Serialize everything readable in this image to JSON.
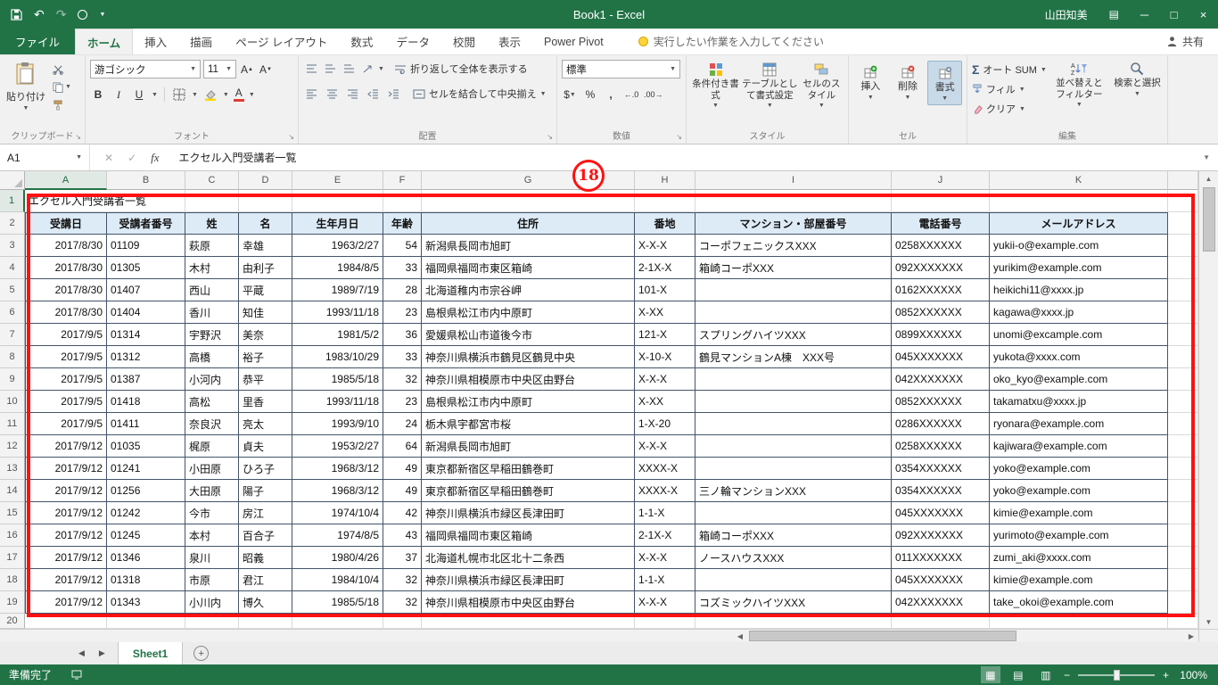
{
  "title_bar": {
    "title": "Book1 - Excel",
    "user_name": "山田知美",
    "minimize": "─",
    "maximize": "□",
    "close": "×"
  },
  "ribbon_tabs": {
    "file": "ファイル",
    "tabs": [
      "ホーム",
      "挿入",
      "描画",
      "ページ レイアウト",
      "数式",
      "データ",
      "校閲",
      "表示",
      "Power Pivot"
    ],
    "tell_me": "実行したい作業を入力してください",
    "share": "共有"
  },
  "ribbon": {
    "clipboard": {
      "paste_label": "貼り付け",
      "group_label": "クリップボード"
    },
    "font": {
      "font_name": "游ゴシック",
      "font_size": "11",
      "bold": "B",
      "italic": "I",
      "underline": "U",
      "group_label": "フォント"
    },
    "alignment": {
      "wrap_label": "折り返して全体を表示する",
      "merge_label": "セルを結合して中央揃え",
      "group_label": "配置"
    },
    "number": {
      "format_value": "標準",
      "currency": "$",
      "percent": "%",
      "comma": ",",
      "increase_decimal": "←.0",
      "decrease_decimal": ".00→",
      "group_label": "数値"
    },
    "styles": {
      "conditional_label": "条件付き書式",
      "table_label": "テーブルとして書式設定",
      "cell_styles_label": "セルのスタイル",
      "group_label": "スタイル"
    },
    "cells": {
      "insert_label": "挿入",
      "delete_label": "削除",
      "format_label": "書式",
      "group_label": "セル"
    },
    "editing": {
      "autosum_label": "オート SUM",
      "fill_label": "フィル",
      "clear_label": "クリア",
      "sort_label": "並べ替えとフィルター",
      "find_label": "検索と選択",
      "group_label": "編集"
    }
  },
  "formula_bar": {
    "name_box": "A1",
    "formula": "エクセル入門受講者一覧",
    "fx": "fx",
    "cancel": "✕",
    "enter": "✓"
  },
  "annotation": {
    "step_number": "18",
    "color": "#ff1111"
  },
  "sheet": {
    "columns": [
      "A",
      "B",
      "C",
      "D",
      "E",
      "F",
      "G",
      "H",
      "I",
      "J",
      "K"
    ],
    "title_cell": "エクセル入門受講者一覧",
    "header_row": [
      "受講日",
      "受講者番号",
      "姓",
      "名",
      "生年月日",
      "年齢",
      "住所",
      "番地",
      "マンション・部屋番号",
      "電話番号",
      "メールアドレス"
    ],
    "rows": [
      [
        "2017/8/30",
        "01109",
        "萩原",
        "幸雄",
        "1963/2/27",
        "54",
        "新潟県長岡市旭町",
        "X-X-X",
        "コーポフェニックスXXX",
        "0258XXXXXX",
        "yukii-o@example.com"
      ],
      [
        "2017/8/30",
        "01305",
        "木村",
        "由利子",
        "1984/8/5",
        "33",
        "福岡県福岡市東区箱崎",
        "2-1X-X",
        "箱崎コーポXXX",
        "092XXXXXXX",
        "yurikim@example.com"
      ],
      [
        "2017/8/30",
        "01407",
        "西山",
        "平蔵",
        "1989/7/19",
        "28",
        "北海道稚内市宗谷岬",
        "101-X",
        "",
        "0162XXXXXX",
        "heikichi11@xxxx.jp"
      ],
      [
        "2017/8/30",
        "01404",
        "香川",
        "知佳",
        "1993/11/18",
        "23",
        "島根県松江市内中原町",
        "X-XX",
        "",
        "0852XXXXXX",
        "kagawa@xxxx.jp"
      ],
      [
        "2017/9/5",
        "01314",
        "宇野沢",
        "美奈",
        "1981/5/2",
        "36",
        "愛媛県松山市道後今市",
        "121-X",
        "スプリングハイツXXX",
        "0899XXXXXX",
        "unomi@excample.com"
      ],
      [
        "2017/9/5",
        "01312",
        "高橋",
        "裕子",
        "1983/10/29",
        "33",
        "神奈川県横浜市鶴見区鶴見中央",
        "X-10-X",
        "鶴見マンションA棟　XXX号",
        "045XXXXXXX",
        "yukota@xxxx.com"
      ],
      [
        "2017/9/5",
        "01387",
        "小河内",
        "恭平",
        "1985/5/18",
        "32",
        "神奈川県相模原市中央区由野台",
        "X-X-X",
        "",
        "042XXXXXXX",
        "oko_kyo@example.com"
      ],
      [
        "2017/9/5",
        "01418",
        "高松",
        "里香",
        "1993/11/18",
        "23",
        "島根県松江市内中原町",
        "X-XX",
        "",
        "0852XXXXXX",
        "takamatxu@xxxx.jp"
      ],
      [
        "2017/9/5",
        "01411",
        "奈良沢",
        "亮太",
        "1993/9/10",
        "24",
        "栃木県宇都宮市桜",
        "1-X-20",
        "",
        "0286XXXXXX",
        "ryonara@example.com"
      ],
      [
        "2017/9/12",
        "01035",
        "梶原",
        "貞夫",
        "1953/2/27",
        "64",
        "新潟県長岡市旭町",
        "X-X-X",
        "",
        "0258XXXXXX",
        "kajiwara@example.com"
      ],
      [
        "2017/9/12",
        "01241",
        "小田原",
        "ひろ子",
        "1968/3/12",
        "49",
        "東京都新宿区早稲田鶴巻町",
        "XXXX-X",
        "",
        "0354XXXXXX",
        "yoko@example.com"
      ],
      [
        "2017/9/12",
        "01256",
        "大田原",
        "陽子",
        "1968/3/12",
        "49",
        "東京都新宿区早稲田鶴巻町",
        "XXXX-X",
        "三ノ輪マンションXXX",
        "0354XXXXXX",
        "yoko@example.com"
      ],
      [
        "2017/9/12",
        "01242",
        "今市",
        "房江",
        "1974/10/4",
        "42",
        "神奈川県横浜市緑区長津田町",
        "1-1-X",
        "",
        "045XXXXXXX",
        "kimie@example.com"
      ],
      [
        "2017/9/12",
        "01245",
        "本村",
        "百合子",
        "1974/8/5",
        "43",
        "福岡県福岡市東区箱崎",
        "2-1X-X",
        "箱崎コーポXXX",
        "092XXXXXXX",
        "yurimoto@example.com"
      ],
      [
        "2017/9/12",
        "01346",
        "泉川",
        "昭義",
        "1980/4/26",
        "37",
        "北海道札幌市北区北十二条西",
        "X-X-X",
        "ノースハウスXXX",
        "011XXXXXXX",
        "zumi_aki@xxxx.com"
      ],
      [
        "2017/9/12",
        "01318",
        "市原",
        "君江",
        "1984/10/4",
        "32",
        "神奈川県横浜市緑区長津田町",
        "1-1-X",
        "",
        "045XXXXXXX",
        "kimie@example.com"
      ],
      [
        "2017/9/12",
        "01343",
        "小川内",
        "博久",
        "1985/5/18",
        "32",
        "神奈川県相模原市中央区由野台",
        "X-X-X",
        "コズミックハイツXXX",
        "042XXXXXXX",
        "take_okoi@example.com"
      ]
    ]
  },
  "sheet_tabs": {
    "active": "Sheet1",
    "add": "+"
  },
  "status_bar": {
    "mode": "準備完了",
    "zoom": "100%",
    "zoom_out": "−",
    "zoom_in": "+"
  }
}
